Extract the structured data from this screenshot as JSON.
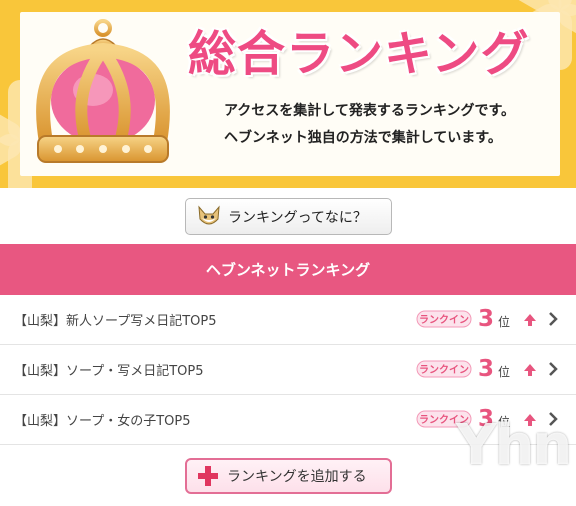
{
  "banner": {
    "title": "総合ランキング",
    "desc_line1": "アクセスを集計して発表するランキングです。",
    "desc_line2": "ヘブンネット独自の方法で集計しています。"
  },
  "whatis_button": {
    "label": "ランキングってなに？",
    "icon": "fox-mascot-icon"
  },
  "section": {
    "title": "ヘブンネットランキング"
  },
  "rows": [
    {
      "label": "【山梨】新人ソープ写メ日記TOP5",
      "badge": "ランクイン",
      "rank": "3",
      "suffix": "位",
      "trend": "up-arrow-icon"
    },
    {
      "label": "【山梨】ソープ・写メ日記TOP5",
      "badge": "ランクイン",
      "rank": "3",
      "suffix": "位",
      "trend": "up-arrow-icon"
    },
    {
      "label": "【山梨】ソープ・女の子TOP5",
      "badge": "ランクイン",
      "rank": "3",
      "suffix": "位",
      "trend": "up-arrow-icon"
    }
  ],
  "add_button": {
    "label": "ランキングを追加する",
    "icon": "plus-icon"
  },
  "watermark": "Yhn",
  "colors": {
    "accent": "#e85781",
    "banner_bg": "#f9c63a",
    "rank_number": "#e8557f"
  }
}
